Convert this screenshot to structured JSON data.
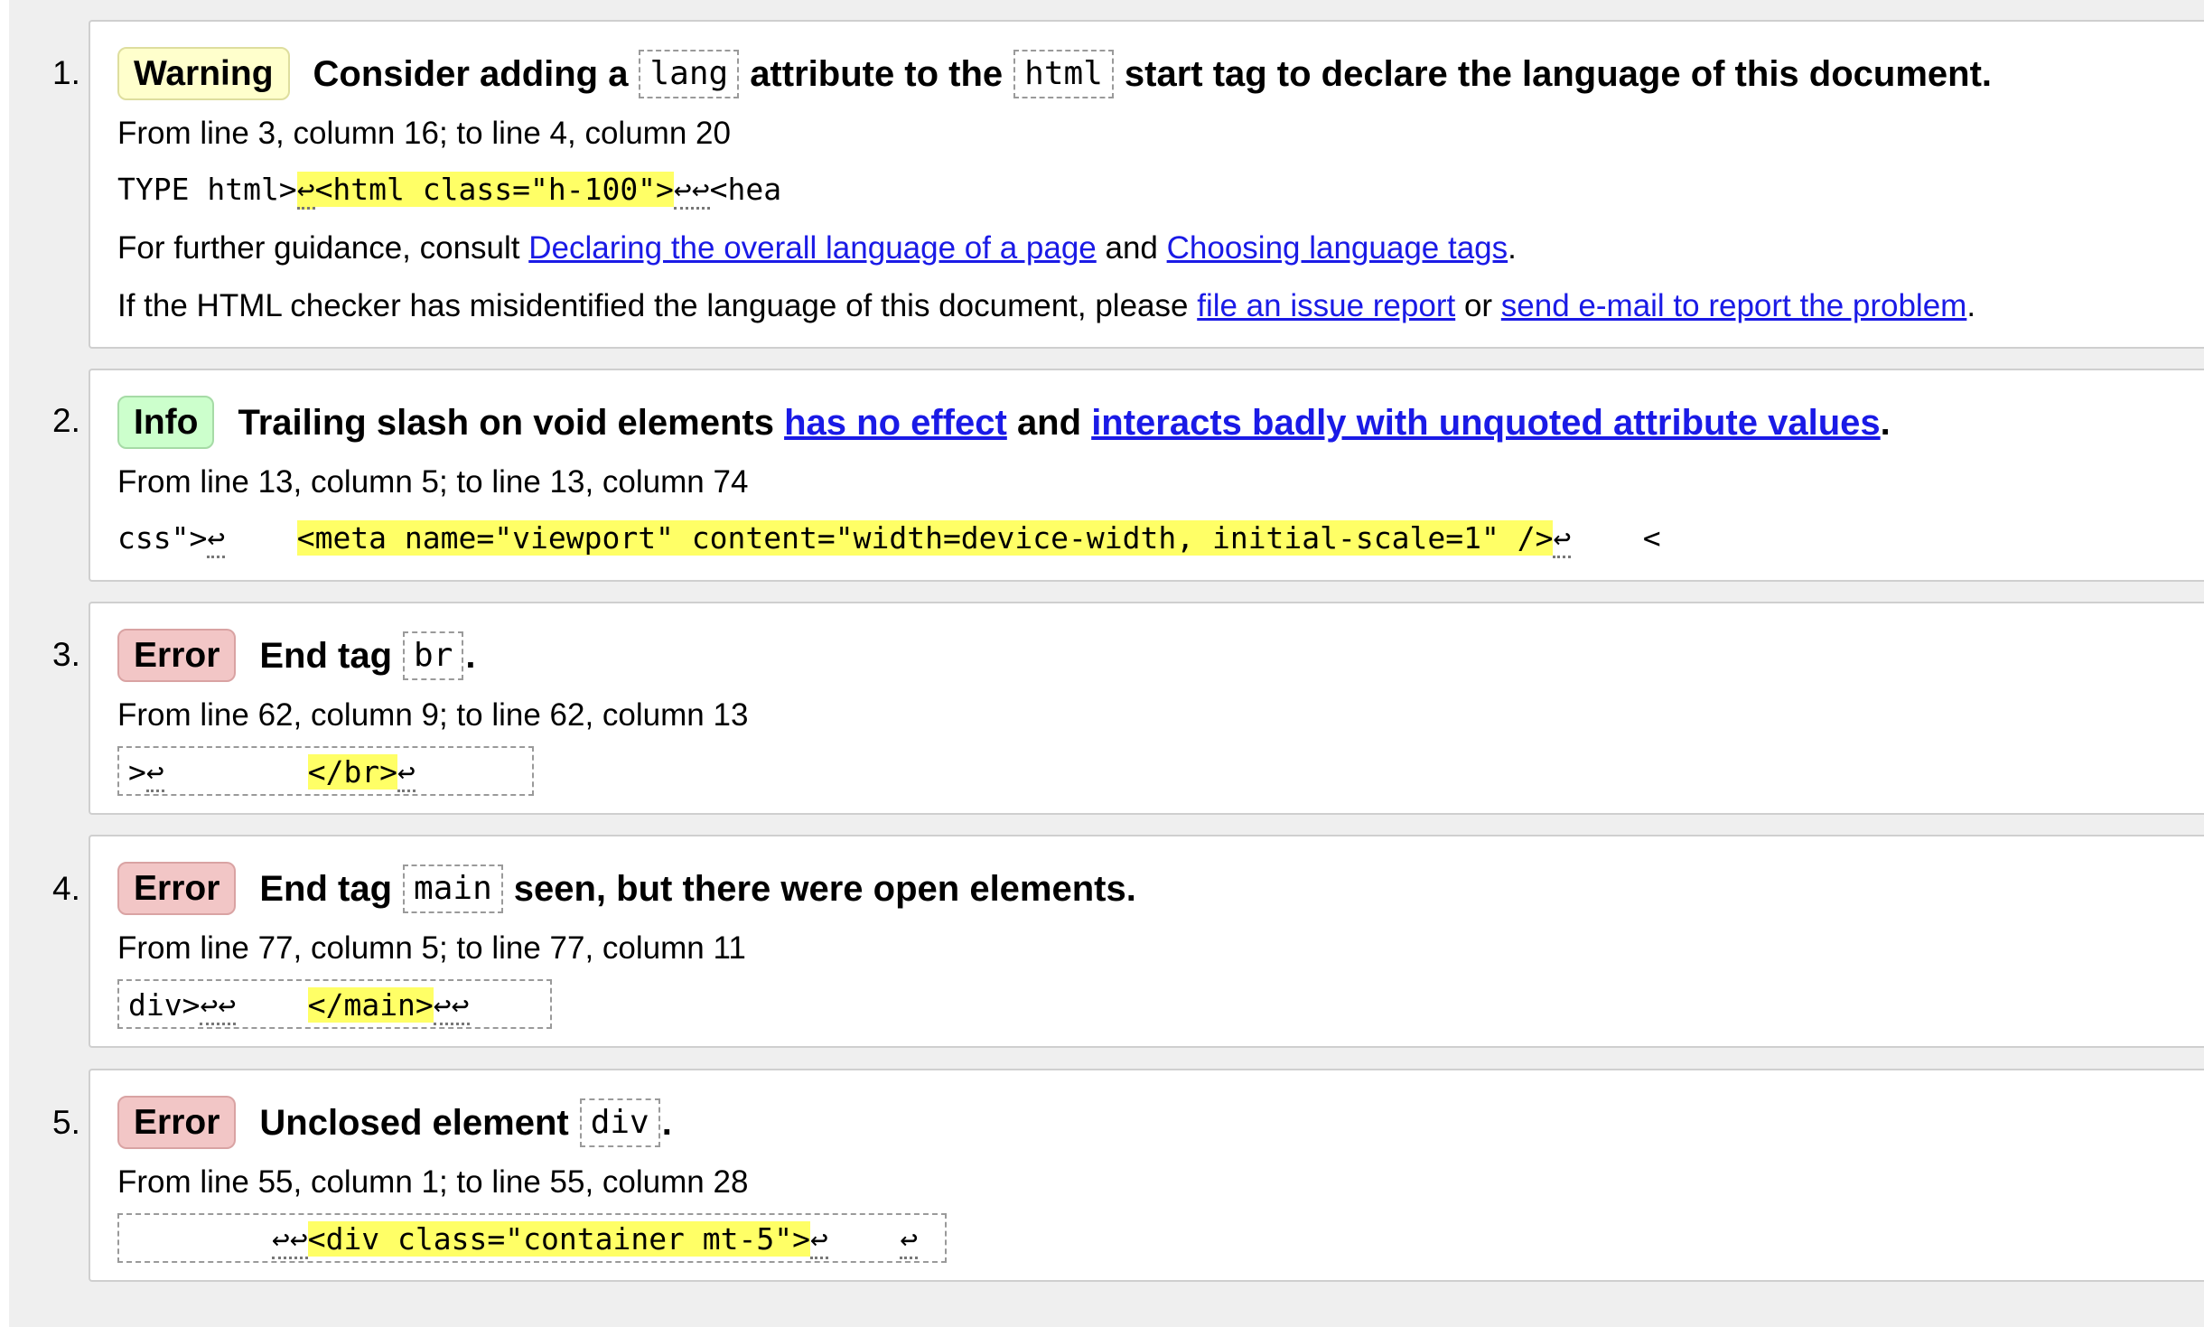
{
  "messages": [
    {
      "number": "1.",
      "type": "Warning",
      "title_parts": [
        "Consider adding a",
        "lang",
        "attribute to the",
        "html",
        "start tag to declare the language of this document."
      ],
      "location": "From line 3, column 16; to line 4, column 20",
      "extract": {
        "before": "TYPE html>",
        "lf1": "↩",
        "highlight": "<html class=\"h-100\">",
        "lf2": "↩↩",
        "after": "<hea"
      },
      "guidance": {
        "prefix": "For further guidance, consult",
        "link1": "Declaring the overall language of a page",
        "mid": "and",
        "link2": "Choosing language tags",
        "suffix": "."
      },
      "issue": {
        "prefix": "If the HTML checker has misidentified the language of this document, please",
        "link1": "file an issue report",
        "mid": "or",
        "link2": "send e-mail to report the problem",
        "suffix": "."
      }
    },
    {
      "number": "2.",
      "type": "Info",
      "title_text": "Trailing slash on void elements",
      "title_link1": "has no effect",
      "title_mid": "and",
      "title_link2": "interacts badly with unquoted attribute values",
      "title_end": ".",
      "location": "From line 13, column 5; to line 13, column 74",
      "extract": {
        "before": "css\">",
        "lf1": "↩",
        "gap": "    ",
        "highlight": "<meta name=\"viewport\" content=\"width=device-width, initial-scale=1\" />",
        "lf2": "↩",
        "after": "    <"
      }
    },
    {
      "number": "3.",
      "type": "Error",
      "title_parts": [
        "End tag",
        "br",
        "."
      ],
      "location": "From line 62, column 9; to line 62, column 13",
      "extract": {
        "before": ">",
        "lf1": "↩",
        "gap": "        ",
        "highlight": "</br>",
        "lf2": "↩",
        "after": "      "
      }
    },
    {
      "number": "4.",
      "type": "Error",
      "title_parts": [
        "End tag",
        "main",
        "seen, but there were open elements."
      ],
      "location": "From line 77, column 5; to line 77, column 11",
      "extract": {
        "before": "div>",
        "lf1": "↩↩",
        "gap": "    ",
        "highlight": "</main>",
        "lf2": "↩↩",
        "after": "    "
      }
    },
    {
      "number": "5.",
      "type": "Error",
      "title_parts": [
        "Unclosed element",
        "div",
        "."
      ],
      "location": "From line 55, column 1; to line 55, column 28",
      "extract": {
        "before": "        ",
        "lf1": "↩↩",
        "highlight": "<div class=\"container mt-5\">",
        "lf2": "↩",
        "gap": "    ",
        "lf3": "↩",
        "after": " "
      }
    }
  ]
}
